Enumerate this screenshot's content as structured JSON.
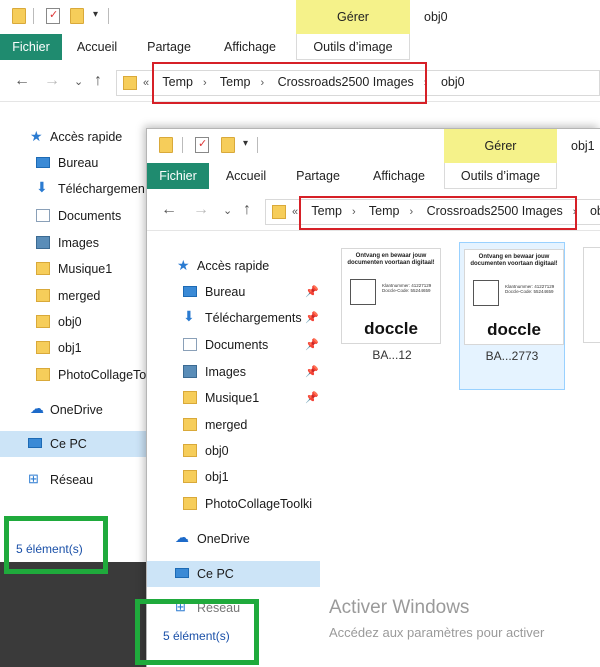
{
  "window_back": {
    "tab_title": "obj0",
    "gerer_label": "Gérer",
    "ribbon_tabs": [
      "Fichier",
      "Accueil",
      "Partage",
      "Affichage",
      "Outils d’image"
    ],
    "breadcrumb": [
      "Temp",
      "Temp",
      "Crossroads2500 Images",
      "obj0"
    ],
    "sidebar": {
      "quick_access": "Accès rapide",
      "items": [
        "Bureau",
        "Téléchargemen",
        "Documents",
        "Images",
        "Musique1",
        "merged",
        "obj0",
        "obj1",
        "PhotoCollageToolk"
      ],
      "onedrive": "OneDrive",
      "this_pc": "Ce PC",
      "network": "Réseau"
    },
    "status": "5 élément(s)"
  },
  "window_front": {
    "tab_title": "obj1",
    "gerer_label": "Gérer",
    "ribbon_tabs": [
      "Fichier",
      "Accueil",
      "Partage",
      "Affichage",
      "Outils d’image"
    ],
    "breadcrumb": [
      "Temp",
      "Temp",
      "Crossroads2500 Images",
      "obj"
    ],
    "sidebar": {
      "quick_access": "Accès rapide",
      "items": [
        "Bureau",
        "Téléchargements",
        "Documents",
        "Images",
        "Musique1",
        "merged",
        "obj0",
        "obj1",
        "PhotoCollageToolki"
      ],
      "onedrive": "OneDrive",
      "this_pc": "Ce PC",
      "network": "Réseau"
    },
    "status": "5 élément(s)",
    "thumbnails": [
      {
        "heading": "Ontvang en bewaar jouw documenten voortaan digitaal!",
        "fields": "Klantnummer: 41227129  Doccle-Code: 55244659",
        "logo": "doccle",
        "label": "BA...12"
      },
      {
        "heading": "Ontvang en bewaar jouw documenten voortaan digitaal!",
        "fields": "Klantnummer: 41227129  Doccle-Code: 55244659",
        "logo": "doccle",
        "label": "BA...2773"
      }
    ]
  },
  "activate": {
    "title": "Activer Windows",
    "subtitle": "Accédez aux paramètres pour activer"
  }
}
